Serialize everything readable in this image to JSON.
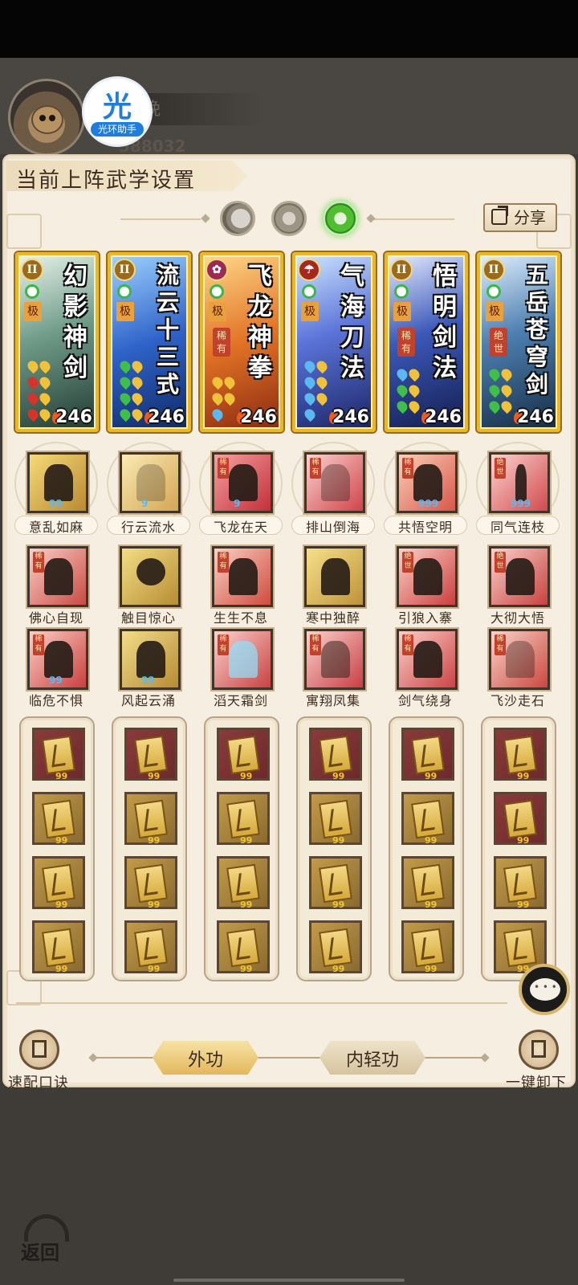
{
  "header": {
    "player_name": "晚",
    "player_id": "588032",
    "badge_char": "光",
    "badge_text": "光环助手"
  },
  "panel": {
    "title": "当前上阵武学设置",
    "share_label": "分享"
  },
  "cards": [
    {
      "name": "幻影神剑",
      "grade": "极",
      "tag": "",
      "level": "246",
      "rank_icon": "II"
    },
    {
      "name": "流云十三式",
      "grade": "极",
      "tag": "",
      "level": "246",
      "rank_icon": "II"
    },
    {
      "name": "飞龙神拳",
      "grade": "极",
      "tag": "稀有",
      "level": "246",
      "rank_icon": "flower"
    },
    {
      "name": "气海刀法",
      "grade": "极",
      "tag": "",
      "level": "246",
      "rank_icon": "umbrella"
    },
    {
      "name": "悟明剑法",
      "grade": "极",
      "tag": "稀有",
      "level": "246",
      "rank_icon": "II"
    },
    {
      "name": "五岳苍穹剑",
      "grade": "极",
      "tag": "绝世",
      "level": "246",
      "rank_icon": "II"
    }
  ],
  "skills_row1": [
    {
      "label": "意乱如麻",
      "tag": ""
    },
    {
      "label": "行云流水",
      "tag": ""
    },
    {
      "label": "飞龙在天",
      "tag": "稀有"
    },
    {
      "label": "排山倒海",
      "tag": "稀有"
    },
    {
      "label": "共悟空明",
      "tag": "稀有"
    },
    {
      "label": "同气连枝",
      "tag": "绝世"
    }
  ],
  "skills_row2": [
    {
      "label": "佛心自现",
      "tag": "稀有"
    },
    {
      "label": "触目惊心",
      "tag": ""
    },
    {
      "label": "生生不息",
      "tag": "稀有"
    },
    {
      "label": "寒中独醉",
      "tag": ""
    },
    {
      "label": "引狼入寨",
      "tag": "绝世"
    },
    {
      "label": "大彻大悟",
      "tag": "绝世"
    }
  ],
  "skills_row3": [
    {
      "label": "临危不惧",
      "tag": "稀有"
    },
    {
      "label": "风起云涌",
      "tag": ""
    },
    {
      "label": "滔天霜剑",
      "tag": "稀有"
    },
    {
      "label": "寓翔凤集",
      "tag": "稀有"
    },
    {
      "label": "剑气绕身",
      "tag": "稀有"
    },
    {
      "label": "飞沙走石",
      "tag": "稀有"
    }
  ],
  "bottom": {
    "left_label": "速配口诀",
    "right_label": "一键卸下",
    "tab_active": "外功",
    "tab_inactive": "内轻功",
    "back_label": "返回"
  },
  "colors": {
    "card_gold": "#e8b829",
    "panel_bg": "#f6eee0",
    "active_jade": "#4fbf2f"
  }
}
